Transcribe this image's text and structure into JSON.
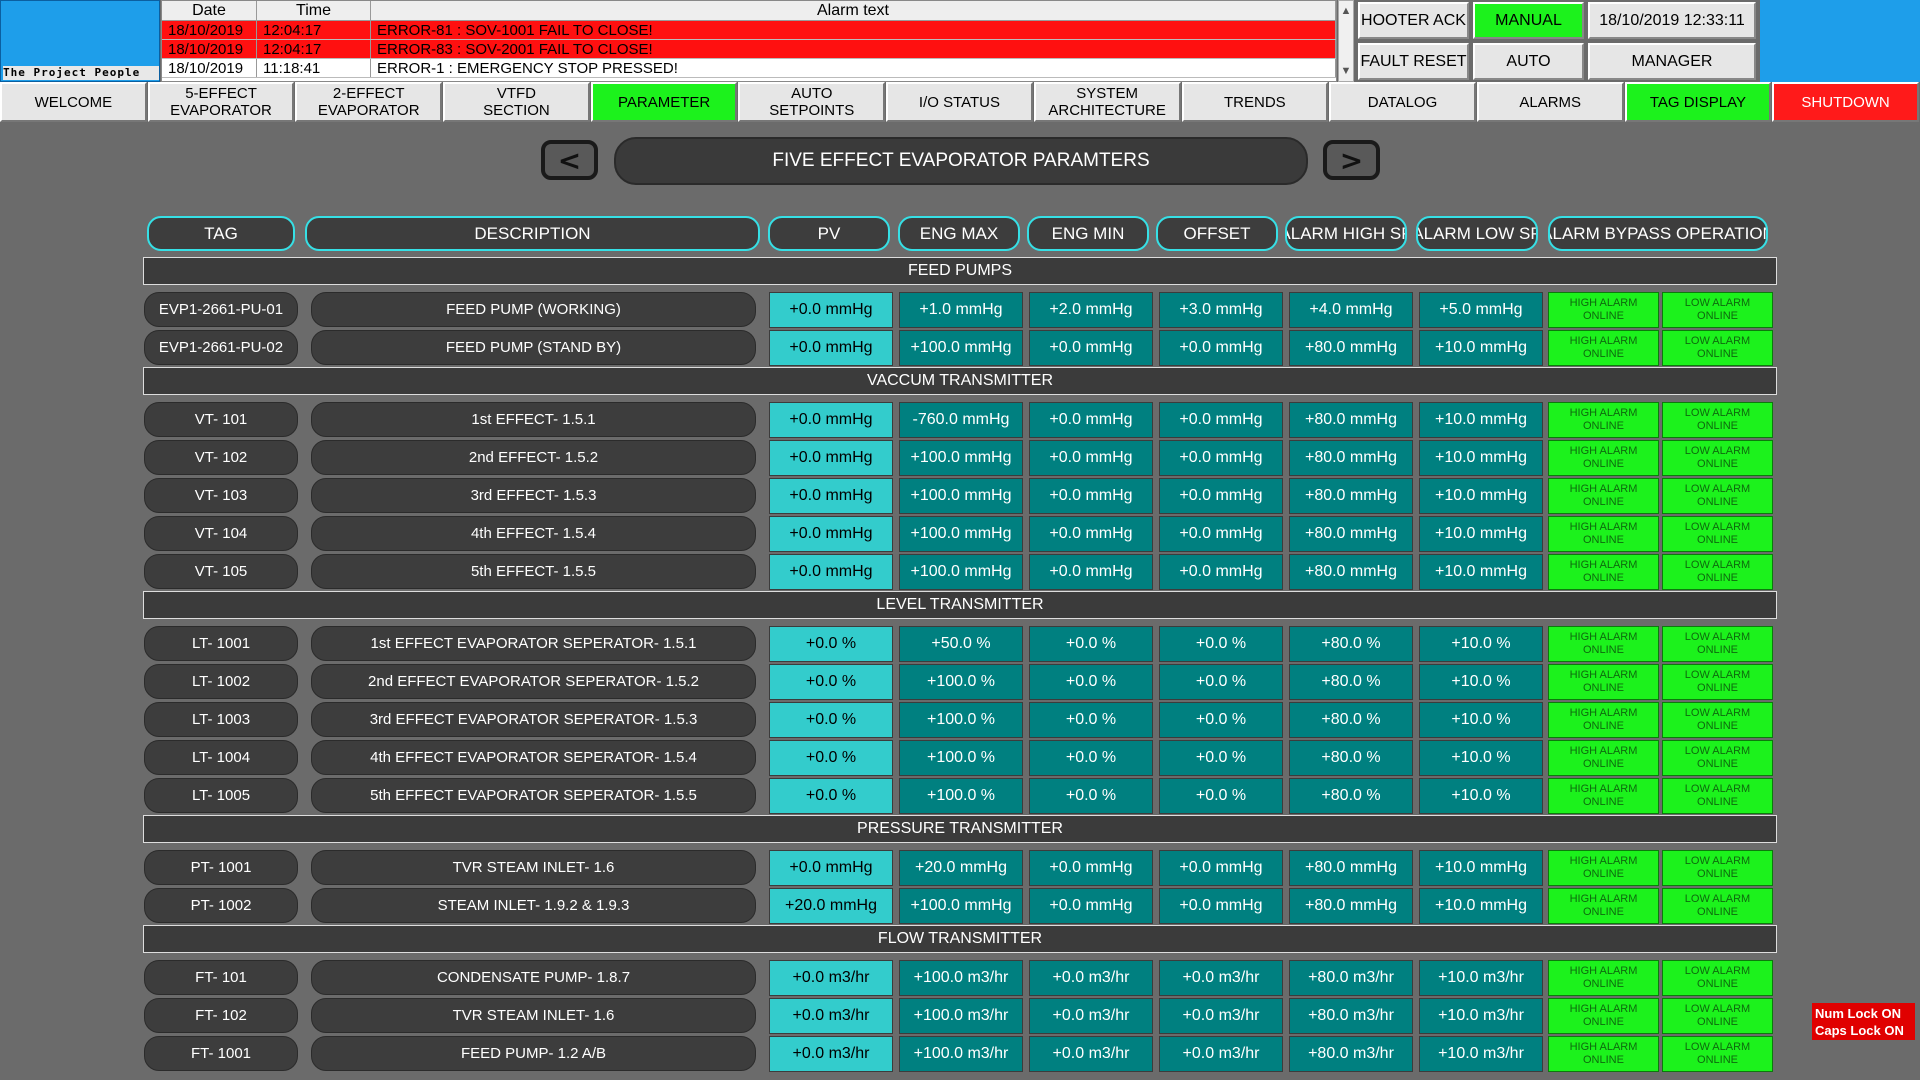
{
  "logo": {
    "text": "The Project People"
  },
  "alarm_table": {
    "headers": {
      "date": "Date",
      "time": "Time",
      "text": "Alarm text"
    },
    "rows": [
      {
        "date": "18/10/2019",
        "time": "12:04:17",
        "text": "ERROR-81 : SOV-1001 FAIL TO CLOSE!",
        "active": true
      },
      {
        "date": "18/10/2019",
        "time": "12:04:17",
        "text": "ERROR-83 : SOV-2001 FAIL TO CLOSE!",
        "active": true
      },
      {
        "date": "18/10/2019",
        "time": "11:18:41",
        "text": "ERROR-1 : EMERGENCY STOP PRESSED!",
        "active": false
      }
    ],
    "scroll_up": "▲",
    "scroll_down": "▼"
  },
  "controls": {
    "hooter_ack": "HOOTER ACK",
    "fault_reset": "FAULT RESET",
    "manual": "MANUAL",
    "auto": "AUTO",
    "datetime": "18/10/2019 12:33:11",
    "user": "MANAGER"
  },
  "nav": [
    {
      "label": "WELCOME",
      "state": "normal"
    },
    {
      "label": "5-EFFECT\nEVAPORATOR",
      "state": "normal"
    },
    {
      "label": "2-EFFECT\nEVAPORATOR",
      "state": "normal"
    },
    {
      "label": "VTFD\nSECTION",
      "state": "normal"
    },
    {
      "label": "PARAMETER",
      "state": "green"
    },
    {
      "label": "AUTO\nSETPOINTS",
      "state": "normal"
    },
    {
      "label": "I/O STATUS",
      "state": "normal"
    },
    {
      "label": "SYSTEM\nARCHITECTURE",
      "state": "normal"
    },
    {
      "label": "TRENDS",
      "state": "normal"
    },
    {
      "label": "DATALOG",
      "state": "normal"
    },
    {
      "label": "ALARMS",
      "state": "normal"
    },
    {
      "label": "TAG DISPLAY",
      "state": "green"
    },
    {
      "label": "SHUTDOWN",
      "state": "red"
    }
  ],
  "page": {
    "title": "FIVE EFFECT EVAPORATOR PARAMTERS",
    "prev_icon": "<",
    "next_icon": ">"
  },
  "columns": [
    "TAG",
    "DESCRIPTION",
    "PV",
    "ENG MAX",
    "ENG MIN",
    "OFFSET",
    "ALARM HIGH SP",
    "ALARM LOW SP",
    "ALARM BYPASS OPERATION"
  ],
  "alarm_buttons": {
    "high": "HIGH ALARM\nONLINE",
    "low": "LOW ALARM\nONLINE"
  },
  "sections": [
    {
      "title": "FEED PUMPS",
      "rows": [
        {
          "tag": "EVP1-2661-PU-01",
          "desc": "FEED PUMP (WORKING)",
          "pv": "+0.0 mmHg",
          "eng_max": "+1.0 mmHg",
          "eng_min": "+2.0 mmHg",
          "offset": "+3.0 mmHg",
          "alarm_high": "+4.0 mmHg",
          "alarm_low": "+5.0 mmHg"
        },
        {
          "tag": "EVP1-2661-PU-02",
          "desc": "FEED PUMP (STAND BY)",
          "pv": "+0.0 mmHg",
          "eng_max": "+100.0 mmHg",
          "eng_min": "+0.0 mmHg",
          "offset": "+0.0 mmHg",
          "alarm_high": "+80.0 mmHg",
          "alarm_low": "+10.0 mmHg"
        }
      ]
    },
    {
      "title": "VACCUM TRANSMITTER",
      "rows": [
        {
          "tag": "VT- 101",
          "desc": "1st EFFECT- 1.5.1",
          "pv": "+0.0 mmHg",
          "eng_max": "-760.0 mmHg",
          "eng_min": "+0.0 mmHg",
          "offset": "+0.0 mmHg",
          "alarm_high": "+80.0 mmHg",
          "alarm_low": "+10.0 mmHg"
        },
        {
          "tag": "VT- 102",
          "desc": "2nd EFFECT- 1.5.2",
          "pv": "+0.0 mmHg",
          "eng_max": "+100.0 mmHg",
          "eng_min": "+0.0 mmHg",
          "offset": "+0.0 mmHg",
          "alarm_high": "+80.0 mmHg",
          "alarm_low": "+10.0 mmHg"
        },
        {
          "tag": "VT- 103",
          "desc": "3rd EFFECT- 1.5.3",
          "pv": "+0.0 mmHg",
          "eng_max": "+100.0 mmHg",
          "eng_min": "+0.0 mmHg",
          "offset": "+0.0 mmHg",
          "alarm_high": "+80.0 mmHg",
          "alarm_low": "+10.0 mmHg"
        },
        {
          "tag": "VT- 104",
          "desc": "4th EFFECT- 1.5.4",
          "pv": "+0.0 mmHg",
          "eng_max": "+100.0 mmHg",
          "eng_min": "+0.0 mmHg",
          "offset": "+0.0 mmHg",
          "alarm_high": "+80.0 mmHg",
          "alarm_low": "+10.0 mmHg"
        },
        {
          "tag": "VT- 105",
          "desc": "5th EFFECT- 1.5.5",
          "pv": "+0.0 mmHg",
          "eng_max": "+100.0 mmHg",
          "eng_min": "+0.0 mmHg",
          "offset": "+0.0 mmHg",
          "alarm_high": "+80.0 mmHg",
          "alarm_low": "+10.0 mmHg"
        }
      ]
    },
    {
      "title": "LEVEL TRANSMITTER",
      "rows": [
        {
          "tag": "LT- 1001",
          "desc": "1st EFFECT EVAPORATOR SEPERATOR- 1.5.1",
          "pv": "+0.0 %",
          "eng_max": "+50.0 %",
          "eng_min": "+0.0 %",
          "offset": "+0.0 %",
          "alarm_high": "+80.0 %",
          "alarm_low": "+10.0 %"
        },
        {
          "tag": "LT- 1002",
          "desc": "2nd EFFECT EVAPORATOR SEPERATOR- 1.5.2",
          "pv": "+0.0 %",
          "eng_max": "+100.0 %",
          "eng_min": "+0.0 %",
          "offset": "+0.0 %",
          "alarm_high": "+80.0 %",
          "alarm_low": "+10.0 %"
        },
        {
          "tag": "LT- 1003",
          "desc": "3rd EFFECT EVAPORATOR SEPERATOR- 1.5.3",
          "pv": "+0.0 %",
          "eng_max": "+100.0 %",
          "eng_min": "+0.0 %",
          "offset": "+0.0 %",
          "alarm_high": "+80.0 %",
          "alarm_low": "+10.0 %"
        },
        {
          "tag": "LT- 1004",
          "desc": "4th EFFECT EVAPORATOR SEPERATOR- 1.5.4",
          "pv": "+0.0 %",
          "eng_max": "+100.0 %",
          "eng_min": "+0.0 %",
          "offset": "+0.0 %",
          "alarm_high": "+80.0 %",
          "alarm_low": "+10.0 %"
        },
        {
          "tag": "LT- 1005",
          "desc": "5th EFFECT EVAPORATOR SEPERATOR- 1.5.5",
          "pv": "+0.0 %",
          "eng_max": "+100.0 %",
          "eng_min": "+0.0 %",
          "offset": "+0.0 %",
          "alarm_high": "+80.0 %",
          "alarm_low": "+10.0 %"
        }
      ]
    },
    {
      "title": "PRESSURE TRANSMITTER",
      "rows": [
        {
          "tag": "PT- 1001",
          "desc": "TVR STEAM INLET- 1.6",
          "pv": "+0.0 mmHg",
          "eng_max": "+20.0 mmHg",
          "eng_min": "+0.0 mmHg",
          "offset": "+0.0 mmHg",
          "alarm_high": "+80.0 mmHg",
          "alarm_low": "+10.0 mmHg"
        },
        {
          "tag": "PT- 1002",
          "desc": "STEAM INLET- 1.9.2 & 1.9.3",
          "pv": "+20.0 mmHg",
          "eng_max": "+100.0 mmHg",
          "eng_min": "+0.0 mmHg",
          "offset": "+0.0 mmHg",
          "alarm_high": "+80.0 mmHg",
          "alarm_low": "+10.0 mmHg"
        }
      ]
    },
    {
      "title": "FLOW TRANSMITTER",
      "rows": [
        {
          "tag": "FT- 101",
          "desc": "CONDENSATE PUMP- 1.8.7",
          "pv": "+0.0 m3/hr",
          "eng_max": "+100.0 m3/hr",
          "eng_min": "+0.0 m3/hr",
          "offset": "+0.0 m3/hr",
          "alarm_high": "+80.0 m3/hr",
          "alarm_low": "+10.0 m3/hr"
        },
        {
          "tag": "FT- 102",
          "desc": "TVR STEAM INLET- 1.6",
          "pv": "+0.0 m3/hr",
          "eng_max": "+100.0 m3/hr",
          "eng_min": "+0.0 m3/hr",
          "offset": "+0.0 m3/hr",
          "alarm_high": "+80.0 m3/hr",
          "alarm_low": "+10.0 m3/hr"
        },
        {
          "tag": "FT- 1001",
          "desc": "FEED PUMP- 1.2 A/B",
          "pv": "+0.0 m3/hr",
          "eng_max": "+100.0 m3/hr",
          "eng_min": "+0.0 m3/hr",
          "offset": "+0.0 m3/hr",
          "alarm_high": "+80.0 m3/hr",
          "alarm_low": "+10.0 m3/hr"
        }
      ]
    }
  ],
  "lock_indicator": {
    "num_lock": "Num Lock ON",
    "caps_lock": "Caps Lock ON"
  },
  "colors": {
    "background": "#6b6b6b",
    "alarm_active": "#ff1010",
    "green_active": "#1cf21c",
    "shutdown_red": "#ff1a1a",
    "value_teal": "#008080",
    "pv_cyan": "#33cccc",
    "header_border_cyan": "#36e0e6",
    "logo_blue": "#1e9eea"
  }
}
